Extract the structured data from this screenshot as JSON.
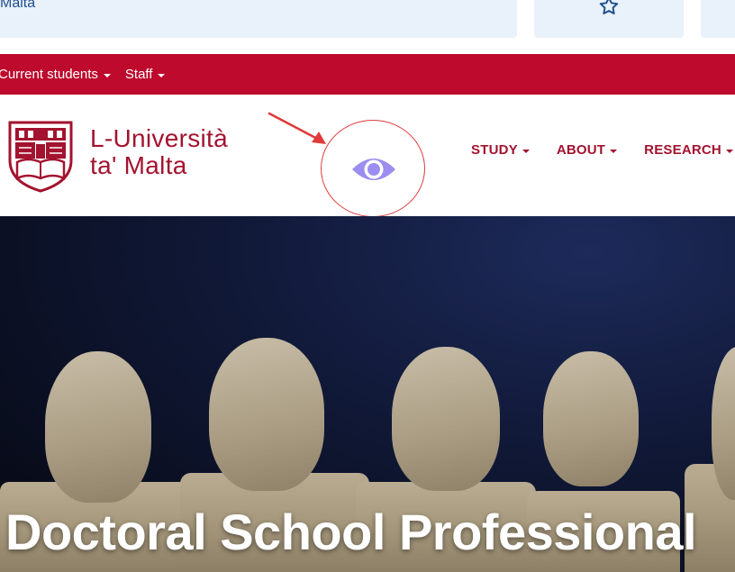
{
  "topbar": {
    "search_text": "Malta",
    "favourite_icon": "star-outline-icon"
  },
  "secondary_nav": {
    "items": [
      {
        "label": "Current students"
      },
      {
        "label": "Staff"
      }
    ]
  },
  "brand": {
    "line1": "L-Università",
    "line2": "ta' Malta",
    "color": "#a3132f"
  },
  "annotation": {
    "target_icon": "eye-icon"
  },
  "main_nav": {
    "items": [
      {
        "label": "STUDY"
      },
      {
        "label": "ABOUT"
      },
      {
        "label": "RESEARCH"
      }
    ]
  },
  "hero": {
    "title": "Doctoral School Professional"
  },
  "colors": {
    "red_bar": "#bd0a2d",
    "eye": "#9b8ef0",
    "annotation": "#e03a3a"
  }
}
